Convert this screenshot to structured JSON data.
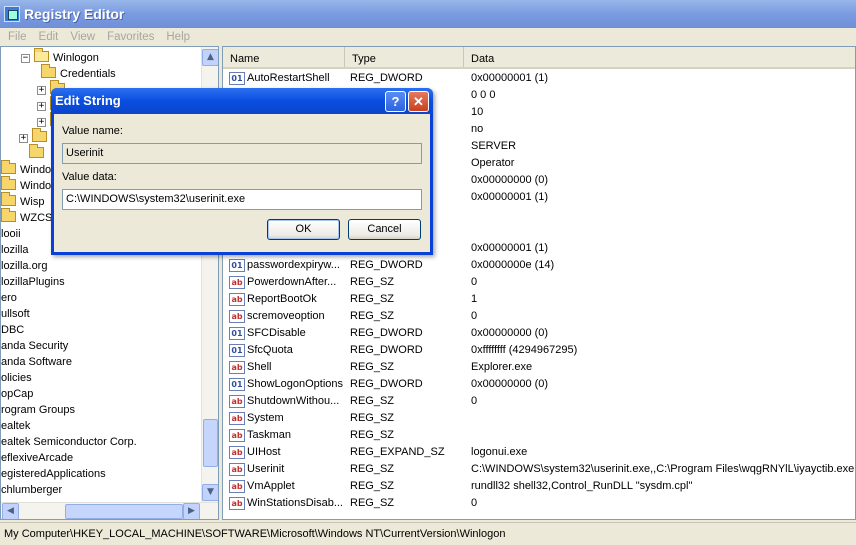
{
  "window": {
    "title": "Registry Editor",
    "icon": "registry-editor-icon"
  },
  "menu": [
    "File",
    "Edit",
    "View",
    "Favorites",
    "Help"
  ],
  "tree": {
    "items": [
      {
        "label": "Winlogon",
        "expander": "−",
        "icon": "folder-open-icon"
      },
      {
        "label": "Credentials",
        "expander": "",
        "icon": "folder-icon"
      },
      {
        "label": "",
        "expander": "+",
        "icon": "folder-icon"
      },
      {
        "label": "",
        "expander": "+",
        "icon": "folder-icon"
      },
      {
        "label": "",
        "expander": "+",
        "icon": "folder-icon"
      },
      {
        "label": "",
        "expander": "+",
        "icon": "folder-icon"
      },
      {
        "label": "",
        "expander": "",
        "icon": "folder-icon"
      },
      {
        "label": "Window",
        "expander": "",
        "icon": "folder-icon"
      },
      {
        "label": "Window",
        "expander": "",
        "icon": "folder-icon"
      },
      {
        "label": "Wisp",
        "expander": "",
        "icon": "folder-icon"
      },
      {
        "label": "WZCSV",
        "expander": "",
        "icon": "folder-icon"
      },
      {
        "label": "looii",
        "expander": "",
        "icon": ""
      },
      {
        "label": "lozilla",
        "expander": "",
        "icon": ""
      },
      {
        "label": "lozilla.org",
        "expander": "",
        "icon": ""
      },
      {
        "label": "lozillaPlugins",
        "expander": "",
        "icon": ""
      },
      {
        "label": "ero",
        "expander": "",
        "icon": ""
      },
      {
        "label": "ullsoft",
        "expander": "",
        "icon": ""
      },
      {
        "label": "DBC",
        "expander": "",
        "icon": ""
      },
      {
        "label": "anda Security",
        "expander": "",
        "icon": ""
      },
      {
        "label": "anda Software",
        "expander": "",
        "icon": ""
      },
      {
        "label": "olicies",
        "expander": "",
        "icon": ""
      },
      {
        "label": "opCap",
        "expander": "",
        "icon": ""
      },
      {
        "label": "rogram Groups",
        "expander": "",
        "icon": ""
      },
      {
        "label": "ealtek",
        "expander": "",
        "icon": ""
      },
      {
        "label": "ealtek Semiconductor Corp.",
        "expander": "",
        "icon": ""
      },
      {
        "label": "eflexiveArcade",
        "expander": "",
        "icon": ""
      },
      {
        "label": "egisteredApplications",
        "expander": "",
        "icon": ""
      },
      {
        "label": "chlumberger",
        "expander": "",
        "icon": ""
      }
    ]
  },
  "list": {
    "columns": [
      "Name",
      "Type",
      "Data"
    ],
    "rows": [
      {
        "name": "AutoRestartShell",
        "type": "REG_DWORD",
        "data": "0x00000001 (1)",
        "icon": "bin"
      },
      {
        "name": "",
        "type": "",
        "data": "0 0 0",
        "icon": ""
      },
      {
        "name": "",
        "type": "",
        "data": "10",
        "icon": ""
      },
      {
        "name": "",
        "type": "",
        "data": "no",
        "icon": ""
      },
      {
        "name": "",
        "type": "",
        "data": "SERVER",
        "icon": ""
      },
      {
        "name": "",
        "type": "",
        "data": "Operator",
        "icon": ""
      },
      {
        "name": "",
        "type": "",
        "data": "0x00000000 (0)",
        "icon": ""
      },
      {
        "name": "",
        "type": "",
        "data": "0x00000001 (1)",
        "icon": ""
      },
      {
        "name": "",
        "type": "",
        "data": "",
        "icon": ""
      },
      {
        "name": "",
        "type": "",
        "data": "",
        "icon": ""
      },
      {
        "name": "",
        "type": "",
        "data": "0x00000001 (1)",
        "icon": ""
      },
      {
        "name": "passwordexpiryw...",
        "type": "REG_DWORD",
        "data": "0x0000000e (14)",
        "icon": "bin"
      },
      {
        "name": "PowerdownAfter...",
        "type": "REG_SZ",
        "data": "0",
        "icon": "ab"
      },
      {
        "name": "ReportBootOk",
        "type": "REG_SZ",
        "data": "1",
        "icon": "ab"
      },
      {
        "name": "scremoveoption",
        "type": "REG_SZ",
        "data": "0",
        "icon": "ab"
      },
      {
        "name": "SFCDisable",
        "type": "REG_DWORD",
        "data": "0x00000000 (0)",
        "icon": "bin"
      },
      {
        "name": "SfcQuota",
        "type": "REG_DWORD",
        "data": "0xffffffff (4294967295)",
        "icon": "bin"
      },
      {
        "name": "Shell",
        "type": "REG_SZ",
        "data": "Explorer.exe",
        "icon": "ab"
      },
      {
        "name": "ShowLogonOptions",
        "type": "REG_DWORD",
        "data": "0x00000000 (0)",
        "icon": "bin"
      },
      {
        "name": "ShutdownWithou...",
        "type": "REG_SZ",
        "data": "0",
        "icon": "ab"
      },
      {
        "name": "System",
        "type": "REG_SZ",
        "data": "",
        "icon": "ab"
      },
      {
        "name": "Taskman",
        "type": "REG_SZ",
        "data": "",
        "icon": "ab"
      },
      {
        "name": "UIHost",
        "type": "REG_EXPAND_SZ",
        "data": "logonui.exe",
        "icon": "ab"
      },
      {
        "name": "Userinit",
        "type": "REG_SZ",
        "data": "C:\\WINDOWS\\system32\\userinit.exe,,C:\\Program Files\\wqgRNYlL\\iyayctib.exe",
        "icon": "ab"
      },
      {
        "name": "VmApplet",
        "type": "REG_SZ",
        "data": "rundll32 shell32,Control_RunDLL \"sysdm.cpl\"",
        "icon": "ab"
      },
      {
        "name": "WinStationsDisab...",
        "type": "REG_SZ",
        "data": "0",
        "icon": "ab"
      }
    ]
  },
  "statusbar": {
    "path": "My Computer\\HKEY_LOCAL_MACHINE\\SOFTWARE\\Microsoft\\Windows NT\\CurrentVersion\\Winlogon"
  },
  "dialog": {
    "title": "Edit String",
    "help_glyph": "?",
    "close_glyph": "✕",
    "value_name_label": "Value name:",
    "value_name": "Userinit",
    "value_data_label": "Value data:",
    "value_data": "C:\\WINDOWS\\system32\\userinit.exe",
    "ok_label": "OK",
    "cancel_label": "Cancel"
  },
  "colors": {
    "accent": "#0a3fd8",
    "title_bar": "#7a9be0",
    "pane_border": "#7f9db9"
  }
}
